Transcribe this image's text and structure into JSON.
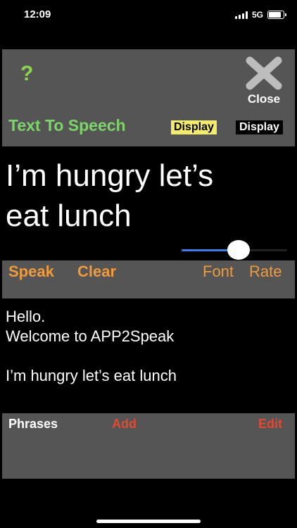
{
  "status": {
    "time": "12:09",
    "network": "5G"
  },
  "header": {
    "help_label": "?",
    "close_label": "Close",
    "title": "Text To Speech",
    "display_yellow": "Display",
    "display_black": "Display"
  },
  "main_text": {
    "line1": "I’m hungry let’s",
    "line2": "eat lunch"
  },
  "rate_slider": {
    "value": 0.55
  },
  "actions": {
    "speak": "Speak",
    "clear": "Clear",
    "font": "Font",
    "rate": "Rate"
  },
  "history": {
    "lines": [
      "Hello.",
      "Welcome to APP2Speak",
      "",
      "I’m hungry let’s eat lunch"
    ]
  },
  "phrases": {
    "title": "Phrases",
    "add": "Add",
    "edit": "Edit"
  },
  "colors": {
    "background": "#000000",
    "panel": "#555555",
    "accent_green": "#7ed46a",
    "accent_orange": "#ef9a3d",
    "accent_red": "#e04a32",
    "display_yellow": "#f2eb6b",
    "slider_blue": "#3b7de8"
  }
}
